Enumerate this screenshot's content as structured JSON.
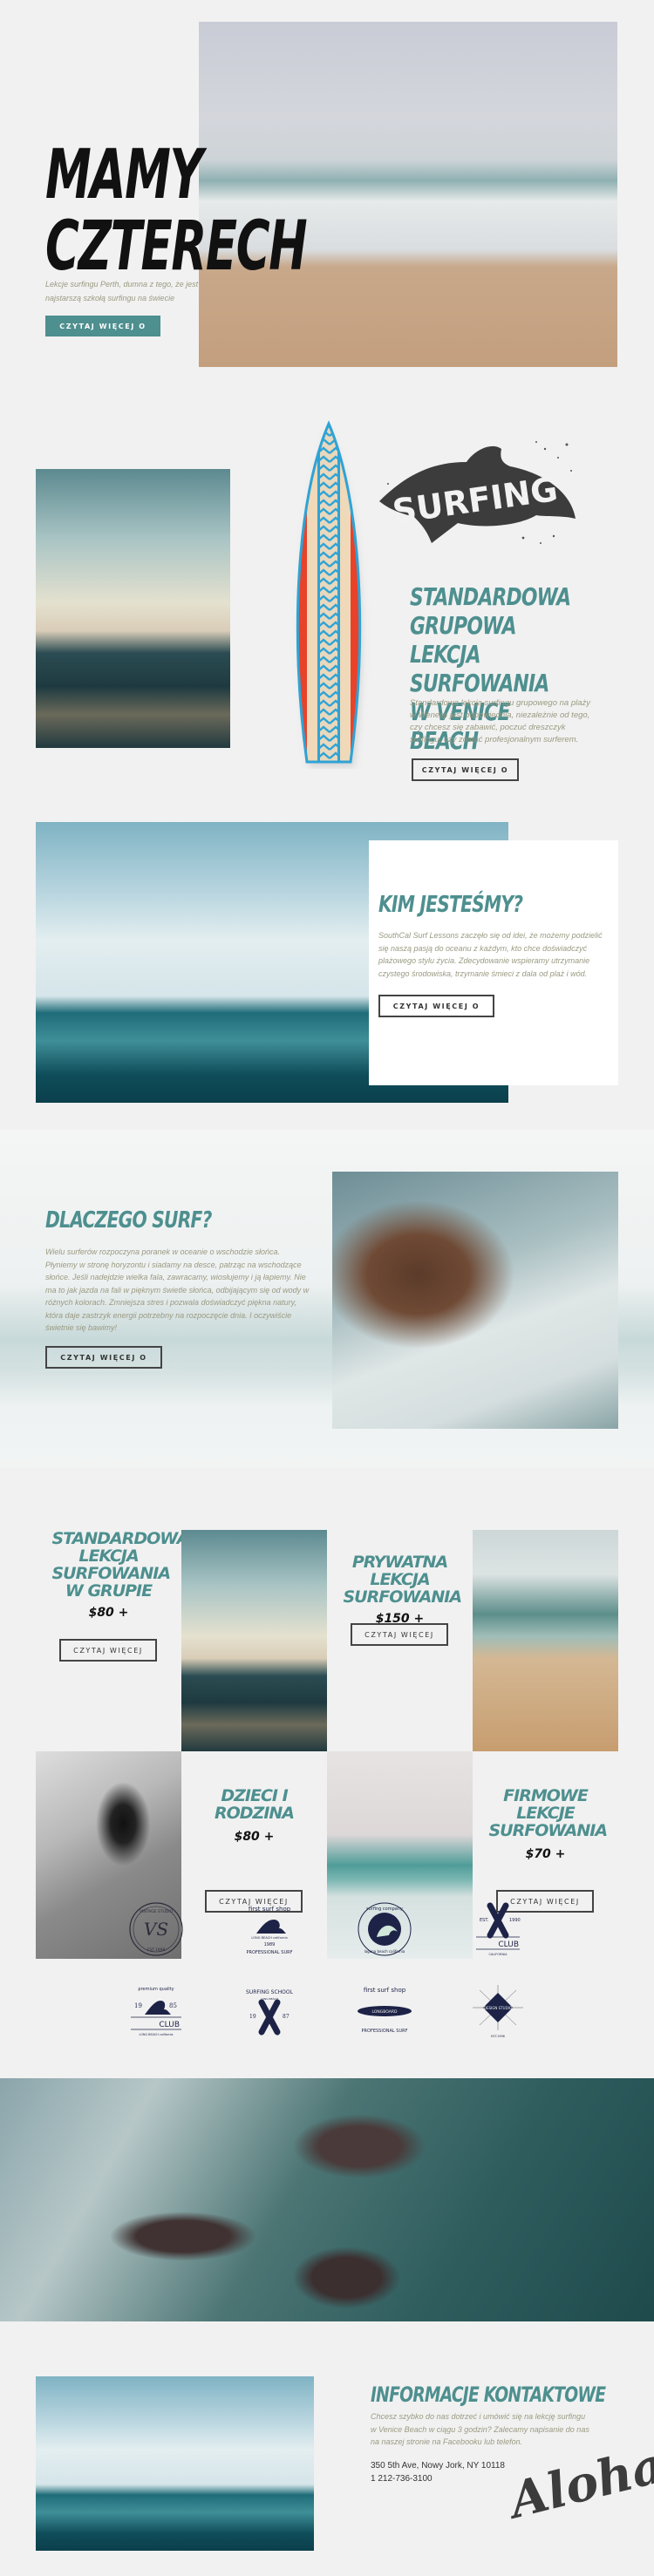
{
  "colors": {
    "accent": "#4e8f8f",
    "background": "#f1f1f1",
    "body_text": "#9a9a82",
    "dark_text": "#222222"
  },
  "hero": {
    "title_line1": "MAMY",
    "title_line2": "CZTERECH",
    "description": "Lekcje surfingu Perth, dumna z tego, że jest najstarszą szkołą surfingu na świecie",
    "button_label": "CZYTAJ WIĘCEJ O",
    "image_alt": "surfer-with-board-on-beach-photo"
  },
  "group_lesson": {
    "image_alt": "surfer-in-sunset-water-photo",
    "surfboard_alt": "surfboard-illustration",
    "dolphin_label": "SURFING",
    "title": "STANDARDOWA GRUPOWA LEKCJA SURFOWANIA W VENICE BEACH",
    "description": "Standardowa lekcja surfingu grupowego na plaży w Wenecji jest odpowiednia, niezależnie od tego, czy chcesz się zabawić, poczuć dreszczyk surfingu, czy zostać profesjonalnym surferem.",
    "button_label": "CZYTAJ WIĘCEJ O"
  },
  "about": {
    "image_alt": "surfer-riding-wave-photo",
    "title": "KIM JESTEŚMY?",
    "description": "SouthCal Surf Lessons zaczęło się od idei, że możemy podzielić się naszą pasją do oceanu z każdym, kto chce doświadczyć plażowego stylu życia. Zdecydowanie wspieramy utrzymanie czystego środowiska, trzymanie śmieci z dala od plaż i wód.",
    "button_label": "CZYTAJ WIĘCEJ O"
  },
  "why": {
    "title": "DLACZEGO SURF?",
    "description": "Wielu surferów rozpoczyna poranek w oceanie o wschodzie słońca. Płyniemy w stronę horyzontu i siadamy na desce, patrząc na wschodzące słońce. Jeśli nadejdzie wielka fala, zawracamy, wiosłujemy i ją łapiemy. Nie ma to jak jazda na fali w pięknym świetle słońca, odbijającym się od wody w różnych kolorach. Zmniejsza stres i pozwala doświadczyć piękna natury, która daje zastrzyk energii potrzebny na rozpoczęcie dnia. I oczywiście świetnie się bawimy!",
    "button_label": "CZYTAJ WIĘCEJ O",
    "image_alt": "surfer-in-spray-photo"
  },
  "pricing": {
    "items": [
      {
        "title": "STANDARDOWA LEKCJA SURFOWANIA W GRUPIE",
        "price": "$80 +",
        "button_label": "CZYTAJ WIĘCEJ",
        "image_alt": "surfer-sunset-photo"
      },
      {
        "title": "PRYWATNA LEKCJA SURFOWANIA",
        "price": "$150 +",
        "button_label": "CZYTAJ WIĘCEJ",
        "image_alt": "couple-with-boards-photo"
      },
      {
        "title": "DZIECI I RODZINA",
        "price": "$80 +",
        "button_label": "CZYTAJ WIĘCEJ",
        "image_alt": "bw-surfer-photo"
      },
      {
        "title": "FIRMOWE LEKCJE SURFOWANIA",
        "price": "$70 +",
        "button_label": "CZYTAJ WIĘCEJ",
        "image_alt": "surfer-on-green-wave-photo"
      }
    ]
  },
  "logos": [
    {
      "name": "vintage-studio-logo",
      "top": "VINTAGE STUDIO",
      "center": "VS",
      "bottom": "EST.1998"
    },
    {
      "name": "first-surf-shop-logo",
      "top": "first surf shop",
      "center": "LONG BEACH california",
      "year": "1989",
      "bottom": "PROFESSIONAL SURF"
    },
    {
      "name": "surfing-company-logo",
      "top": "surfing company",
      "bottom": "laguna beach california"
    },
    {
      "name": "club-california-logo",
      "left": "EST.",
      "right": "1990",
      "center": "CLUB",
      "bottom": "CALIFORNIA"
    },
    {
      "name": "premium-quality-club-logo",
      "top": "premium quality",
      "left": "19",
      "right": "85",
      "center": "CLUB",
      "bottom": "LONG BEACH california"
    },
    {
      "name": "surfing-school-logo",
      "top": "SURFING SCHOOL",
      "sub": "LONG BEACH",
      "left": "19",
      "right": "87"
    },
    {
      "name": "longboard-surf-shop-logo",
      "top": "first surf shop",
      "center": "LONGBOARD",
      "bottom": "PROFESSIONAL SURF"
    },
    {
      "name": "design-studio-logo",
      "center": "DESIGN STUDIO",
      "bottom": "EST.1998"
    }
  ],
  "banner": {
    "image_alt": "aerial-rocks-ocean-photo"
  },
  "contact": {
    "image_alt": "surfer-on-wave-photo",
    "title": "INFORMACJE KONTAKTOWE",
    "description": "Chcesz szybko do nas dotrzeć i umówić się na lekcję surfingu w Venice Beach w ciągu 3 godzin? Zalecamy napisanie do nas na naszej stronie na Facebooku lub telefon.",
    "address": "350 5th Ave, Nowy Jork, NY 10118",
    "phone": "1 212-736-3100",
    "signature": "Aloha"
  }
}
